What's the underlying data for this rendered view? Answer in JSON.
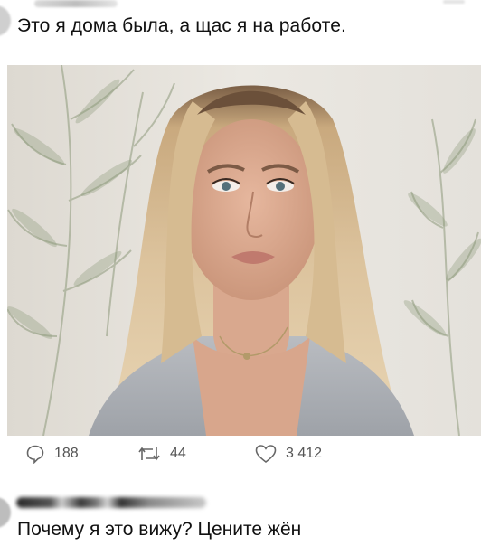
{
  "post": {
    "text": "Это я дома была, а щас я на работе."
  },
  "actions": {
    "replies": {
      "icon": "comment-icon",
      "count": "188"
    },
    "reposts": {
      "icon": "repost-icon",
      "count": "44"
    },
    "likes": {
      "icon": "heart-icon",
      "count": "3 412"
    }
  },
  "reply": {
    "text": "Почему я это вижу? Цените жён"
  },
  "colors": {
    "background": "#ffffff",
    "text": "#111111",
    "icon": "#666666",
    "count": "#555555",
    "blur_gray": "#cfcfcf"
  }
}
